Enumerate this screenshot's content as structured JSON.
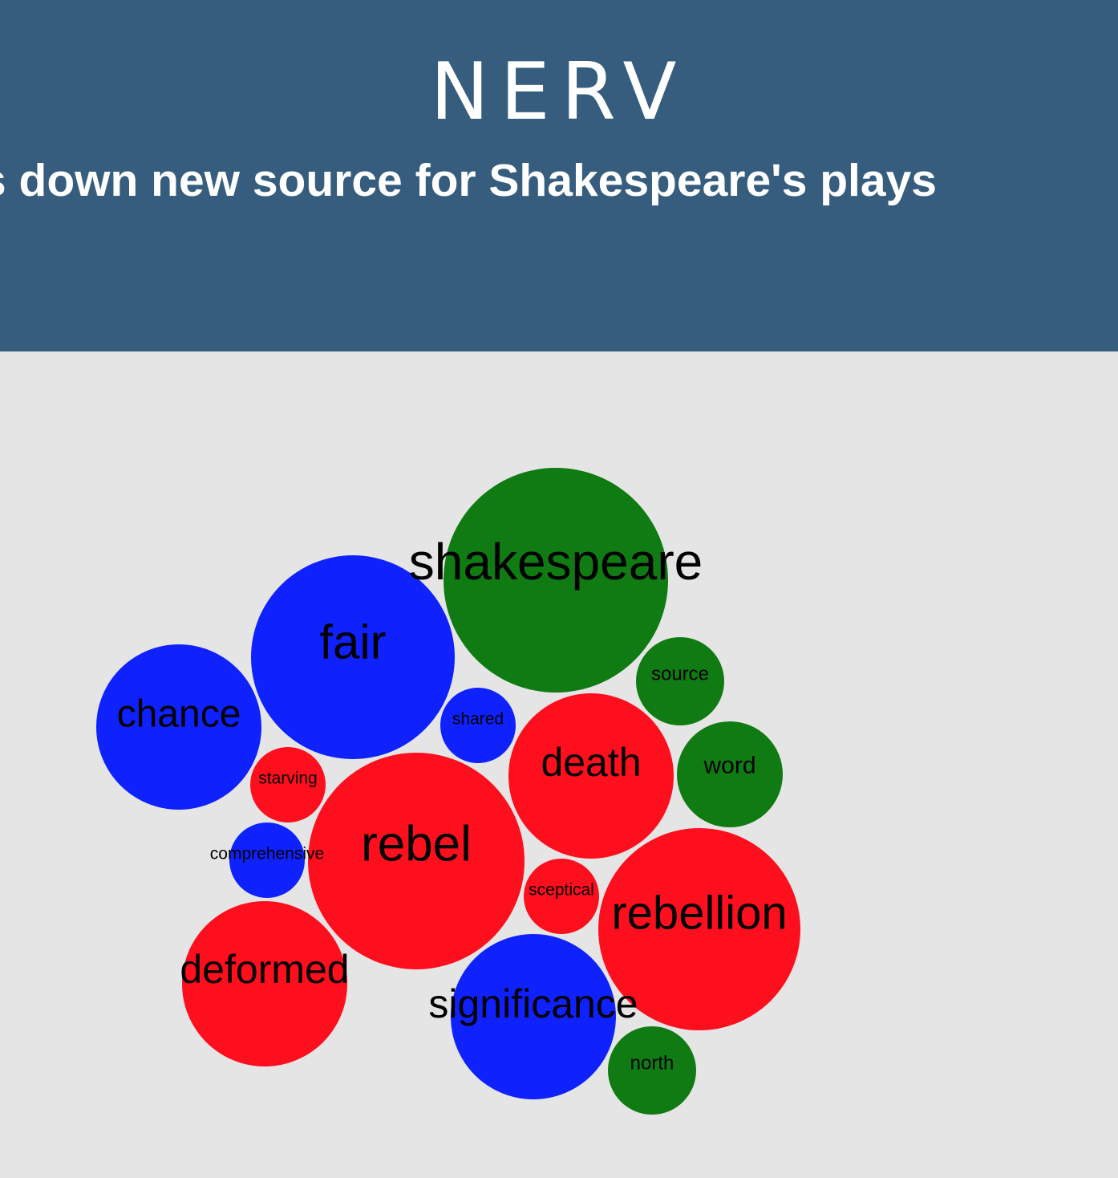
{
  "header": {
    "app_title": "NERV",
    "headline": "Software pins down new source for Shakespeare's plays"
  },
  "colors": {
    "header_bg": "#365d7e",
    "page_bg": "#e5e5e5",
    "red": "#fe0f1e",
    "blue": "#0f22fe",
    "green": "#0f7b12"
  },
  "bubbles": [
    {
      "word": "shakespeare",
      "group": "green"
    },
    {
      "word": "fair",
      "group": "blue"
    },
    {
      "word": "chance",
      "group": "blue"
    },
    {
      "word": "source",
      "group": "green"
    },
    {
      "word": "shared",
      "group": "blue"
    },
    {
      "word": "death",
      "group": "red"
    },
    {
      "word": "word",
      "group": "green"
    },
    {
      "word": "starving",
      "group": "red"
    },
    {
      "word": "rebel",
      "group": "red"
    },
    {
      "word": "comprehensive",
      "group": "blue"
    },
    {
      "word": "sceptical",
      "group": "red"
    },
    {
      "word": "rebellion",
      "group": "red"
    },
    {
      "word": "deformed",
      "group": "red"
    },
    {
      "word": "significance",
      "group": "blue"
    },
    {
      "word": "north",
      "group": "green"
    }
  ]
}
